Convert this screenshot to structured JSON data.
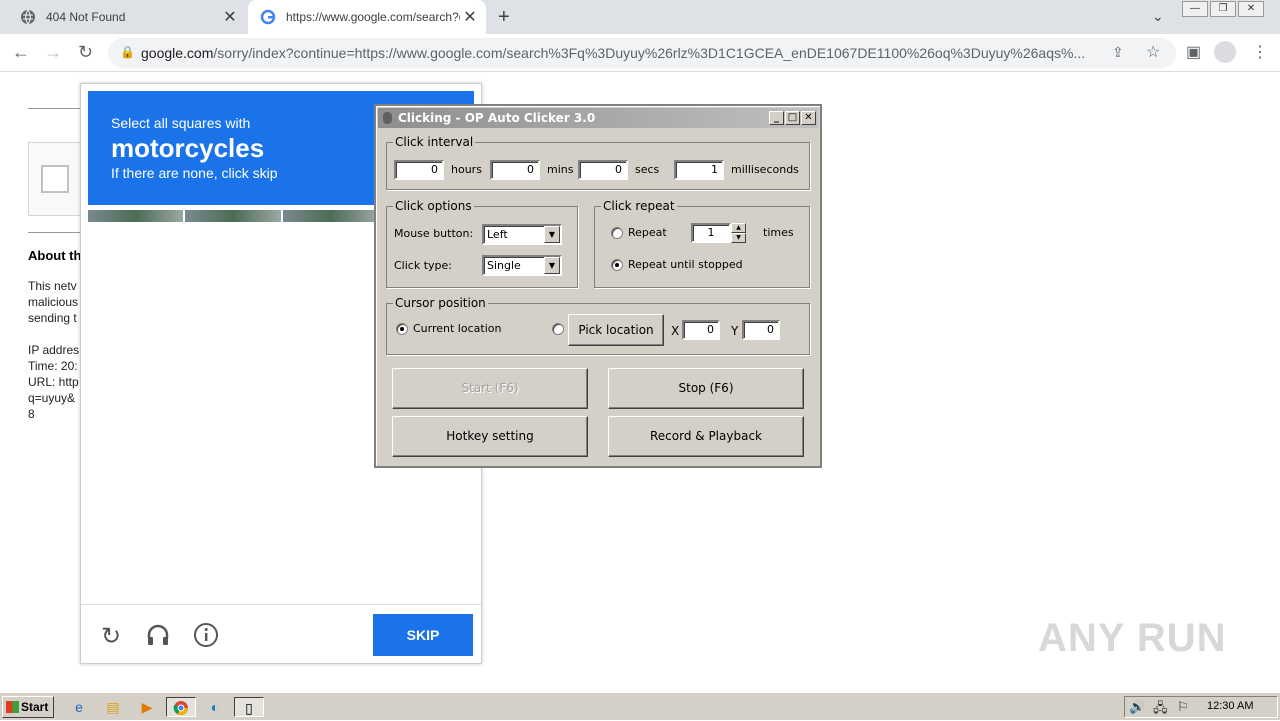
{
  "tabs": [
    {
      "title": "404 Not Found",
      "icon": "globe-icon"
    },
    {
      "title": "https://www.google.com/search?q=",
      "icon": "google-icon"
    }
  ],
  "address_bar": {
    "domain": "google.com",
    "path": "/sorry/index?continue=https://www.google.com/search%3Fq%3Duyuy%26rlz%3D1C1GCEA_enDE1067DE1100%26oq%3Duyuy%26aqs%..."
  },
  "page": {
    "about_heading": "About th",
    "lines": [
      "This netv",
      "malicious",
      "sending t",
      "IP addres",
      "Time: 20:",
      "URL: http",
      "q=uyuy&",
      "8"
    ]
  },
  "captcha": {
    "line1": "Select all squares with",
    "keyword": "motorcycles",
    "line3": "If there are none, click skip",
    "skip_label": "SKIP"
  },
  "autoclicker": {
    "title": "Clicking - OP Auto Clicker 3.0",
    "interval": {
      "legend": "Click interval",
      "hours": "0",
      "hours_label": "hours",
      "mins": "0",
      "mins_label": "mins",
      "secs": "0",
      "secs_label": "secs",
      "ms": "1",
      "ms_label": "milliseconds"
    },
    "options": {
      "legend": "Click options",
      "mouse_label": "Mouse button:",
      "mouse_value": "Left",
      "type_label": "Click type:",
      "type_value": "Single"
    },
    "repeat": {
      "legend": "Click repeat",
      "repeat_label": "Repeat",
      "repeat_value": "1",
      "times_label": "times",
      "until_label": "Repeat until stopped"
    },
    "cursor": {
      "legend": "Cursor position",
      "current_label": "Current location",
      "pick_label": "Pick location",
      "x_label": "X",
      "x_value": "0",
      "y_label": "Y",
      "y_value": "0"
    },
    "buttons": {
      "start": "Start (F6)",
      "stop": "Stop (F6)",
      "hotkey": "Hotkey setting",
      "record": "Record & Playback"
    }
  },
  "watermark": "ANY RUN",
  "taskbar": {
    "start_label": "Start",
    "clock": "12:30 AM"
  }
}
